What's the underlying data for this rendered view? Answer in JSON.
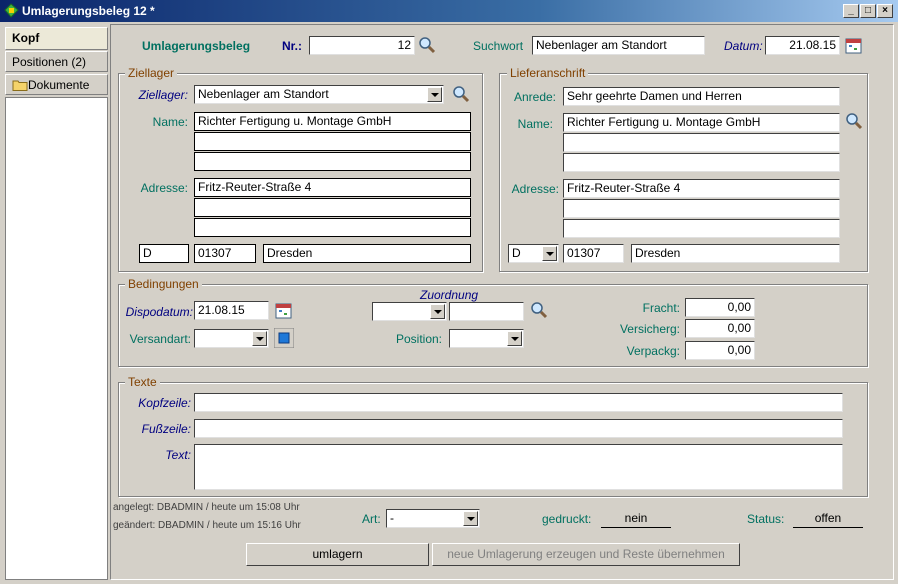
{
  "window": {
    "title": "Umlagerungsbeleg 12 *",
    "min": "_",
    "max": "□",
    "close": "×"
  },
  "sidebar": {
    "tabs": [
      {
        "label": "Kopf"
      },
      {
        "label": "Positionen (2)"
      },
      {
        "label": "Dokumente"
      }
    ]
  },
  "header": {
    "section_title": "Umlagerungsbeleg",
    "nr_label": "Nr.:",
    "nr_value": "12",
    "suchwort_label": "Suchwort",
    "suchwort_value": "Nebenlager am Standort",
    "datum_label": "Datum:",
    "datum_value": "21.08.15"
  },
  "ziellager": {
    "legend": "Ziellager",
    "lager_label": "Ziellager:",
    "lager_value": "Nebenlager am Standort",
    "name_label": "Name:",
    "name1": "Richter Fertigung u. Montage GmbH",
    "name2": "",
    "name3": "",
    "adresse_label": "Adresse:",
    "adr1": "Fritz-Reuter-Straße 4",
    "adr2": "",
    "adr3": "",
    "land": "D",
    "plz": "01307",
    "ort": "Dresden"
  },
  "liefer": {
    "legend": "Lieferanschrift",
    "anrede_label": "Anrede:",
    "anrede_value": "Sehr geehrte Damen und Herren",
    "name_label": "Name:",
    "name1": "Richter Fertigung u. Montage GmbH",
    "name2": "",
    "name3": "",
    "adresse_label": "Adresse:",
    "adr1": "Fritz-Reuter-Straße 4",
    "adr2": "",
    "adr3": "",
    "land": "D",
    "plz": "01307",
    "ort": "Dresden"
  },
  "bedingungen": {
    "legend": "Bedingungen",
    "dispodatum_label": "Dispodatum:",
    "dispodatum_value": "21.08.15",
    "versandart_label": "Versandart:",
    "versandart_value": "",
    "zuordnung_label": "Zuordnung",
    "zuordnung_value": "",
    "position_label": "Position:",
    "position_value": "",
    "fracht_label": "Fracht:",
    "fracht_value": "0,00",
    "versich_label": "Versicherg:",
    "versich_value": "0,00",
    "verpack_label": "Verpackg:",
    "verpack_value": "0,00"
  },
  "texte": {
    "legend": "Texte",
    "kopf_label": "Kopfzeile:",
    "kopf_value": "",
    "fuss_label": "Fußzeile:",
    "fuss_value": "",
    "text_label": "Text:",
    "text_value": ""
  },
  "footer": {
    "angelegt": "angelegt: DBADMIN / heute um 15:08 Uhr",
    "geaendert": "geändert: DBADMIN / heute um 15:16 Uhr",
    "art_label": "Art:",
    "art_value": "-",
    "gedruckt_label": "gedruckt:",
    "gedruckt_value": "nein",
    "status_label": "Status:",
    "status_value": "offen",
    "umlagern_label": "umlagern",
    "neue_label": "neue Umlagerung erzeugen und Reste übernehmen"
  },
  "colors": {
    "label_green": "#007060",
    "label_blue": "#000080",
    "legend_brown": "#804000",
    "titlebar": "#0a246a"
  }
}
